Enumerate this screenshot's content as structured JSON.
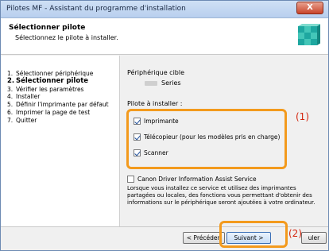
{
  "window": {
    "title": "Pilotes MF - Assistant du programme d'installation",
    "close_label": "X"
  },
  "header": {
    "title": "Sélectionner pilote",
    "subtitle": "Sélectionnez le pilote à installer."
  },
  "steps": [
    {
      "num": "1.",
      "label": "Sélectionner périphérique"
    },
    {
      "num": "2.",
      "label": "Sélectionner pilote"
    },
    {
      "num": "3.",
      "label": "Vérifier les paramètres"
    },
    {
      "num": "4.",
      "label": "Installer"
    },
    {
      "num": "5.",
      "label": "Définir l'imprimante par défaut"
    },
    {
      "num": "6.",
      "label": "Imprimer la page de test"
    },
    {
      "num": "7.",
      "label": "Quitter"
    }
  ],
  "main": {
    "periph_label": "Périphérique cible",
    "periph_value": "Series",
    "pilote_label": "Pilote à installer :",
    "drivers": [
      {
        "label": "Imprimante",
        "checked": true
      },
      {
        "label": "Télécopieur (pour les modèles pris en charge)",
        "checked": true
      },
      {
        "label": "Scanner",
        "checked": true
      }
    ],
    "callout_1": "(1)",
    "assist_label": "Canon Driver Information Assist Service",
    "assist_text": "Lorsque vous installez ce service et utilisez des imprimantes partagées ou locales, des fonctions vous permettant d'obtenir des informations sur le périphérique seront ajoutées à votre ordinateur."
  },
  "footer": {
    "prev_label": "< Précéden",
    "next_label": "Suivant >",
    "cancel_label": "uler",
    "callout_2": "(2)"
  }
}
